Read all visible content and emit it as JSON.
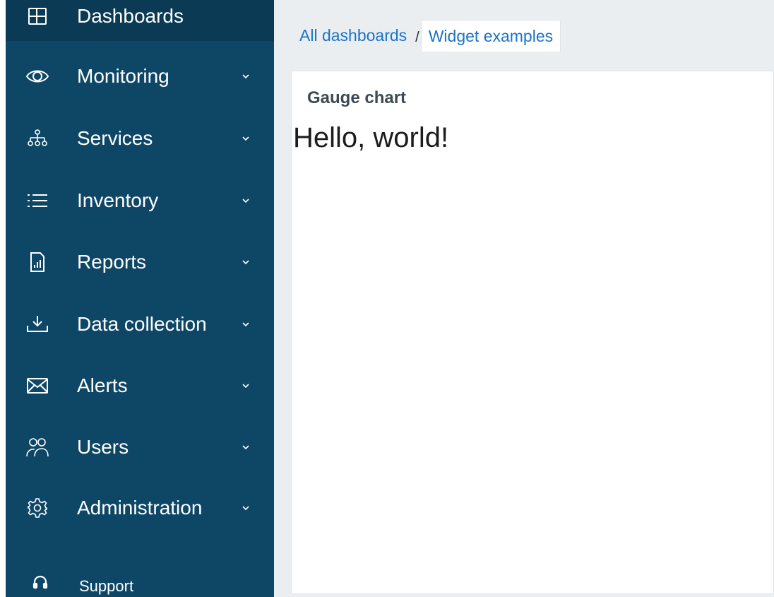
{
  "sidebar": {
    "items": [
      {
        "label": "Dashboards",
        "icon": "dashboard-icon",
        "active": true,
        "has_submenu": false
      },
      {
        "label": "Monitoring",
        "icon": "eye-icon",
        "active": false,
        "has_submenu": true
      },
      {
        "label": "Services",
        "icon": "services-tree-icon",
        "active": false,
        "has_submenu": true
      },
      {
        "label": "Inventory",
        "icon": "list-icon",
        "active": false,
        "has_submenu": true
      },
      {
        "label": "Reports",
        "icon": "report-icon",
        "active": false,
        "has_submenu": true
      },
      {
        "label": "Data collection",
        "icon": "download-icon",
        "active": false,
        "has_submenu": true
      },
      {
        "label": "Alerts",
        "icon": "envelope-icon",
        "active": false,
        "has_submenu": true
      },
      {
        "label": "Users",
        "icon": "users-icon",
        "active": false,
        "has_submenu": true
      },
      {
        "label": "Administration",
        "icon": "gear-icon",
        "active": false,
        "has_submenu": true
      }
    ],
    "support": {
      "label": "Support",
      "icon": "headset-icon"
    }
  },
  "breadcrumb": {
    "items": [
      "All dashboards",
      "Widget examples"
    ],
    "separator": "/"
  },
  "widget": {
    "title": "Gauge chart",
    "body": "Hello, world!"
  },
  "colors": {
    "sidebar_bg": "#0e4766",
    "sidebar_active_bg": "#0b3a54",
    "link": "#1a73c7",
    "page_bg": "#ebeef1"
  }
}
